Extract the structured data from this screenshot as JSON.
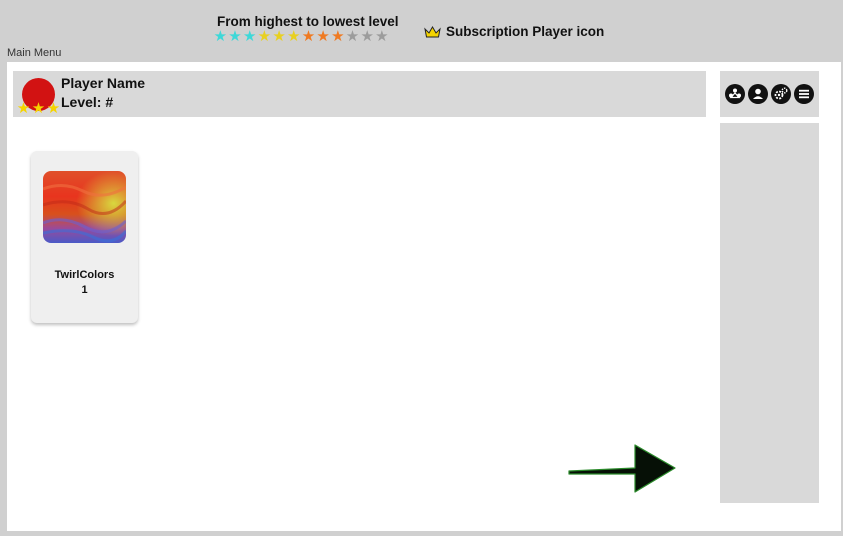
{
  "legend": {
    "title": "From highest to lowest level",
    "stars": [
      {
        "color": "#3ed8d8"
      },
      {
        "color": "#3ed8d8"
      },
      {
        "color": "#3ed8d8"
      },
      {
        "color": "#e8d020"
      },
      {
        "color": "#e8d020"
      },
      {
        "color": "#e8d020"
      },
      {
        "color": "#ef7a22"
      },
      {
        "color": "#ef7a22"
      },
      {
        "color": "#ef7a22"
      },
      {
        "color": "#9c9c9c"
      },
      {
        "color": "#9c9c9c"
      },
      {
        "color": "#9c9c9c"
      }
    ],
    "subscription_icon": "crown-icon",
    "subscription_label": "Subscription Player icon"
  },
  "main_menu_label": "Main Menu",
  "player": {
    "name": "Player Name",
    "level": "Level: #",
    "avatar_color": "#d21212",
    "rank_star_color": "#f5d400",
    "rank_stars": 3
  },
  "toolbar": {
    "icons": [
      "group-icon",
      "profile-icon",
      "settings-icon",
      "menu-icon"
    ]
  },
  "games": [
    {
      "title": "TwirlColors",
      "count": "1"
    }
  ],
  "next_icon": "arrow-right-icon"
}
